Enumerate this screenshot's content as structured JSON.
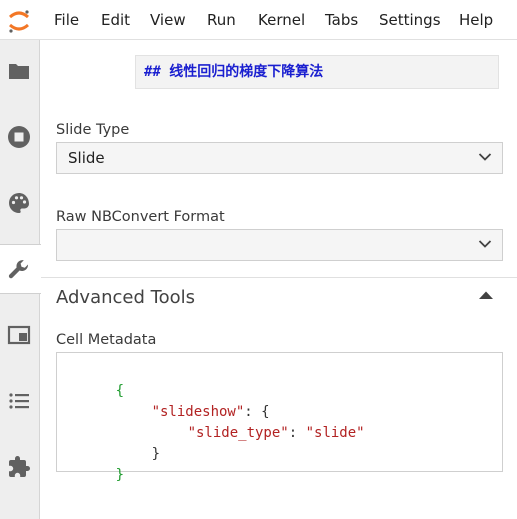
{
  "menubar": {
    "items": [
      "File",
      "Edit",
      "View",
      "Run",
      "Kernel",
      "Tabs",
      "Settings",
      "Help"
    ]
  },
  "sidebar": {
    "tabs": [
      {
        "icon": "folder-icon",
        "active": false
      },
      {
        "icon": "stop-circle-icon",
        "active": false
      },
      {
        "icon": "palette-icon",
        "active": false
      },
      {
        "icon": "wrench-icon",
        "active": true
      },
      {
        "icon": "tab-window-icon",
        "active": false
      },
      {
        "icon": "list-icon",
        "active": false
      },
      {
        "icon": "puzzle-icon",
        "active": false
      }
    ]
  },
  "cell_preview": {
    "text": "## 线性回归的梯度下降算法"
  },
  "slide_type": {
    "label": "Slide Type",
    "value": "Slide"
  },
  "raw_format": {
    "label": "Raw NBConvert Format",
    "value": ""
  },
  "advanced": {
    "title": "Advanced Tools"
  },
  "metadata": {
    "label": "Cell Metadata",
    "open_brace": "{",
    "key_slideshow": "\"slideshow\"",
    "colon_open": ": {",
    "key_slide_type": "\"slide_type\"",
    "colon": ": ",
    "value_slide": "\"slide\"",
    "inner_close": "}",
    "close_brace": "}"
  },
  "colors": {
    "accent": "#1a1fd0",
    "sidebar_bg": "#eeeeee",
    "json_brace": "#1e9b2e",
    "json_string": "#b22222"
  }
}
